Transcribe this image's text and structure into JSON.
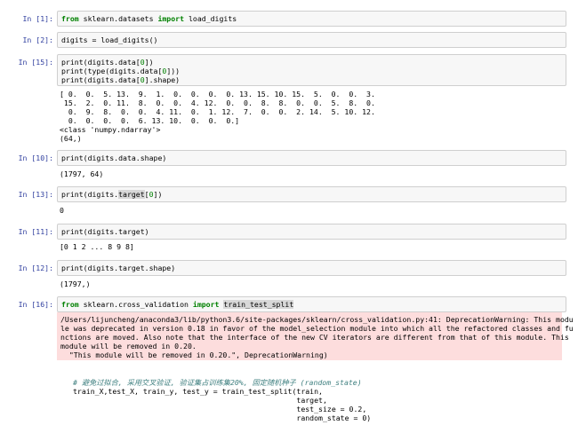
{
  "cells": [
    {
      "prompt": "In [1]:",
      "code": [
        "from sklearn.datasets import load_digits"
      ]
    },
    {
      "prompt": "In [2]:",
      "code": [
        "digits = load_digits()"
      ]
    },
    {
      "prompt": "In [15]:",
      "code": [
        "print(digits.data[0])",
        "print(type(digits.data[0]))",
        "print(digits.data[0].shape)"
      ],
      "output": [
        "[ 0.  0.  5. 13.  9.  1.  0.  0.  0.  0. 13. 15. 10. 15.  5.  0.  0.  3.",
        " 15.  2.  0. 11.  8.  0.  0.  4. 12.  0.  0.  8.  8.  0.  0.  5.  8.  0.",
        "  0.  9.  8.  0.  0.  4. 11.  0.  1. 12.  7.  0.  0.  2. 14.  5. 10. 12.",
        "  0.  0.  0.  0.  6. 13. 10.  0.  0.  0.]",
        "<class 'numpy.ndarray'>",
        "(64,)"
      ]
    },
    {
      "prompt": "In [10]:",
      "code": [
        "print(digits.data.shape)"
      ],
      "output": [
        "(1797, 64)"
      ]
    },
    {
      "prompt": "In [13]:",
      "code": [
        "print(digits.target[0])"
      ],
      "output": [
        "0"
      ]
    },
    {
      "prompt": "In [11]:",
      "code": [
        "print(digits.target)"
      ],
      "output": [
        "[0 1 2 ... 8 9 8]"
      ]
    },
    {
      "prompt": "In [12]:",
      "code": [
        "print(digits.target.shape)"
      ],
      "output": [
        "(1797,)"
      ]
    },
    {
      "prompt": "In [16]:",
      "code": [
        "from sklearn.cross_validation import train_test_split"
      ],
      "stderr": [
        "/Users/lijuncheng/anaconda3/lib/python3.6/site-packages/sklearn/cross_validation.py:41: DeprecationWarning: This modu",
        "le was deprecated in version 0.18 in favor of the model_selection module into which all the refactored classes and fu",
        "nctions are moved. Also note that the interface of the new CV iterators are different from that of this module. This",
        "module will be removed in 0.20.",
        "  \"This module will be removed in 0.20.\", DeprecationWarning)"
      ]
    },
    {
      "prompt": "",
      "code": [
        "# 避免过拟合, 采用交叉验证, 验证集占训练集20%, 固定随机种子 (random_state)",
        "train_X,test_X, train_y, test_y = train_test_split(train,",
        "                                                   target,",
        "                                                   test_size = 0.2,",
        "                                                   random_state = 0)"
      ]
    }
  ]
}
